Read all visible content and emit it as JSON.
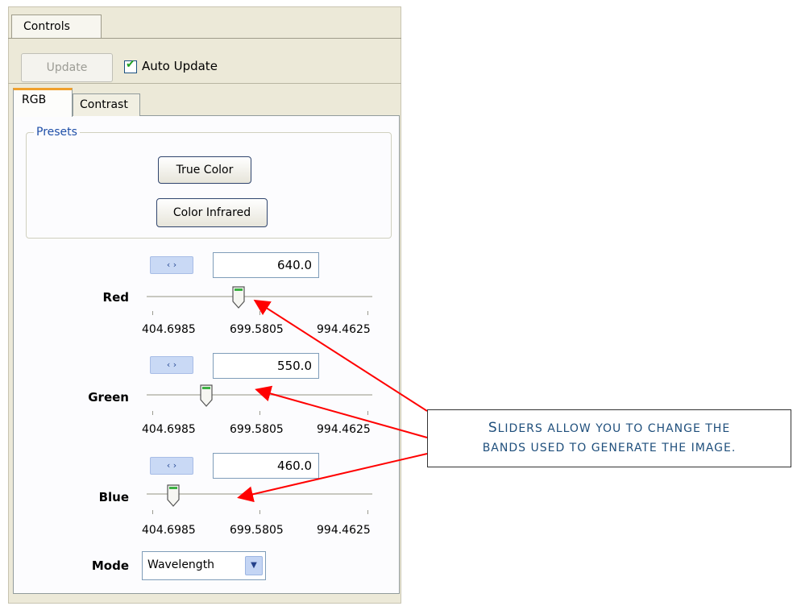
{
  "panel": {
    "tab_label": "Controls",
    "update_label": "Update",
    "auto_update": {
      "label": "Auto Update",
      "checked": true
    }
  },
  "tabs": [
    {
      "label": "RGB",
      "active": true
    },
    {
      "label": "Contrast",
      "active": false
    }
  ],
  "presets": {
    "title": "Presets",
    "buttons": [
      "True Color",
      "Color Infrared"
    ]
  },
  "bands": [
    {
      "label": "Red",
      "value": "640.0",
      "min": 404.6985,
      "max": 994.4625,
      "ticks": [
        "404.6985",
        "699.5805",
        "994.4625"
      ]
    },
    {
      "label": "Green",
      "value": "550.0",
      "min": 404.6985,
      "max": 994.4625,
      "ticks": [
        "404.6985",
        "699.5805",
        "994.4625"
      ]
    },
    {
      "label": "Blue",
      "value": "460.0",
      "min": 404.6985,
      "max": 994.4625,
      "ticks": [
        "404.6985",
        "699.5805",
        "994.4625"
      ]
    }
  ],
  "spin_glyph": "‹ ›",
  "mode": {
    "label": "Mode",
    "value": "Wavelength",
    "arrow": "▼"
  },
  "callout": {
    "line1_first": "S",
    "line1_rest": "LIDERS ALLOW YOU TO CHANGE THE",
    "line2": "BANDS USED TO GENERATE THE IMAGE."
  },
  "colors": {
    "arrow": "#ff0000",
    "tab_accent": "#f0a02c",
    "callout_text": "#1f4f7c"
  }
}
